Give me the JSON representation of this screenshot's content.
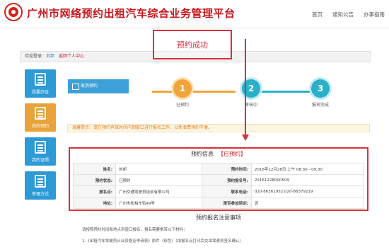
{
  "header": {
    "title": "广州市网络预约出租汽车综合业务管理平台",
    "nav": [
      "首页",
      "通知公告",
      "办事指南"
    ]
  },
  "welcome": {
    "prefix": "欢迎登录：",
    "user": "刘邦",
    "center": "返回个人中心"
  },
  "callout": {
    "text": "预约成功"
  },
  "sidebar": {
    "items": [
      {
        "label": "我要办证"
      },
      {
        "label": "我的预约"
      },
      {
        "label": "我的证照"
      },
      {
        "label": "审理方式"
      }
    ]
  },
  "crumb": {
    "label": "取消预约"
  },
  "steps": [
    {
      "number": "1",
      "label": "已预约"
    },
    {
      "number": "2",
      "label": "审核中"
    },
    {
      "number": "3",
      "label": "报名完成"
    }
  ],
  "tip": {
    "text": "温馨提示：请在预约有效时间内到窗口进行报名工作，以免浪费预约不便。"
  },
  "info": {
    "title": "预约信息",
    "status": "【已预约】",
    "rows": [
      {
        "k1": "姓名:",
        "v1": "刘邦",
        "k2": "预约时间:",
        "v2": "2016年12月28日 上午 08:30 - 09:30"
      },
      {
        "k1": "预约状态:",
        "v1": "已预约",
        "k2": "预约报名号:",
        "v2": "20161228000509"
      },
      {
        "k1": "报名点:",
        "v1": "广州交通驾驶员培训有限公司",
        "k2": "联系电话:",
        "v2": "020-86361952,020-86379219"
      },
      {
        "k1": "地址:",
        "v1": "广州市松柏东街49号",
        "k2": "是否参加培训:",
        "v2": "否"
      }
    ]
  },
  "notice": {
    "title": "预约报名注意事项",
    "lines": [
      "请按照预约时间和地点到窗口报名，报名需要携带以下材料：",
      "1.《出租汽车驾驶员从业资格证申请表》原件（彩色）（由报名点打印后交由驾驶员签名确认）"
    ]
  },
  "colors": {
    "brand_red": "#c8161d",
    "step1": "#f0a43a",
    "step2": "#2ab0c9",
    "step3": "#2ab0c9",
    "sidebar_blue": "#2d9ad6",
    "sidebar_active": "#e8a33a"
  }
}
